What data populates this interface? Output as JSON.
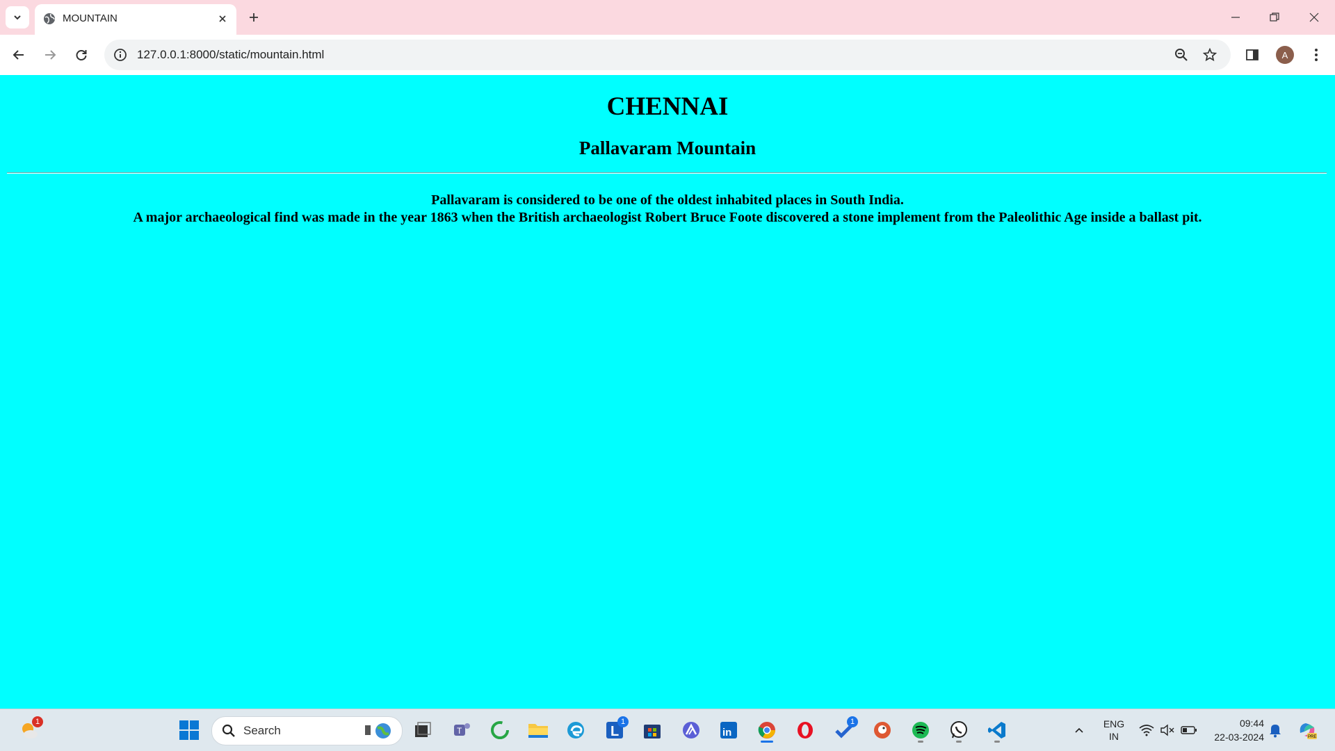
{
  "browser": {
    "tab": {
      "title": "MOUNTAIN"
    },
    "address_bar": {
      "url": "127.0.0.1:8000/static/mountain.html"
    },
    "profile_initial": "A"
  },
  "page": {
    "heading": "CHENNAI",
    "subheading": "Pallavaram Mountain",
    "paragraph_line1": "Pallavaram is considered to be one of the oldest inhabited places in South India.",
    "paragraph_line2": "A major archaeological find was made in the year 1863 when the British archaeologist Robert Bruce Foote discovered a stone implement from the Paleolithic Age inside a ballast pit.",
    "background_color": "#00ffff"
  },
  "taskbar": {
    "search_label": "Search",
    "weather_badge": "1",
    "lens_badge": "1",
    "todo_badge": "1",
    "language_line1": "ENG",
    "language_line2": "IN",
    "time": "09:44",
    "date": "22-03-2024",
    "pinned_icons": [
      "windows-start-icon",
      "search-icon",
      "file-explorer-icon",
      "teams-icon",
      "refresh-app-icon",
      "folder-icon",
      "edge-icon",
      "lens-icon",
      "store-icon",
      "vercel-like-icon",
      "linkedin-icon",
      "chrome-icon",
      "opera-icon",
      "todo-icon",
      "duckduckgo-icon",
      "spotify-icon",
      "whatsapp-icon",
      "vscode-icon"
    ]
  }
}
